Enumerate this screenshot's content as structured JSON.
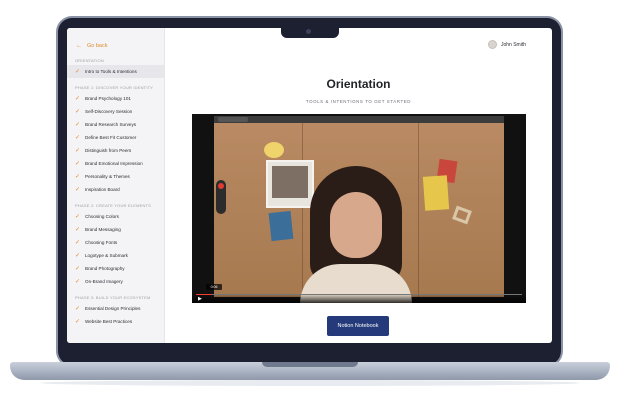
{
  "header": {
    "back_label": "Go back",
    "user_name": "John Smith"
  },
  "sidebar": {
    "sections": [
      {
        "title": "ORIENTATION",
        "items": [
          {
            "label": "Intro to Tools & Intentions"
          }
        ]
      },
      {
        "title": "PHASE 1: DISCOVER YOUR IDENTITY",
        "items": [
          {
            "label": "Brand Psychology 101"
          },
          {
            "label": "Self-Discovery Session"
          },
          {
            "label": "Brand Research Surveys"
          },
          {
            "label": "Define Best Fit Customer"
          },
          {
            "label": "Distinguish from Peers"
          },
          {
            "label": "Brand Emotional Impression"
          },
          {
            "label": "Personality & Themes"
          },
          {
            "label": "Inspiration Board"
          }
        ]
      },
      {
        "title": "PHASE 2: CREATE YOUR ELEMENTS",
        "items": [
          {
            "label": "Choosing Colors"
          },
          {
            "label": "Brand Messaging"
          },
          {
            "label": "Choosing Fonts"
          },
          {
            "label": "Logotype & Submark"
          },
          {
            "label": "Brand Photography"
          },
          {
            "label": "On-Brand Imagery"
          }
        ]
      },
      {
        "title": "PHASE 3: BUILD YOUR ECOSYSTEM",
        "items": [
          {
            "label": "Essential Design Principles"
          },
          {
            "label": "Website Best Practices"
          }
        ]
      }
    ]
  },
  "main": {
    "title": "Orientation",
    "subtitle": "TOOLS & INTENTIONS TO GET STARTED",
    "video": {
      "timestamp": "0:06",
      "progress": 0.05
    },
    "notion_button": "Notion Notebook"
  },
  "colors": {
    "accent": "#e08a2c",
    "button": "#243a7a"
  },
  "icons": {
    "back": "arrow-left-icon",
    "check": "check-icon",
    "play": "play-icon"
  }
}
